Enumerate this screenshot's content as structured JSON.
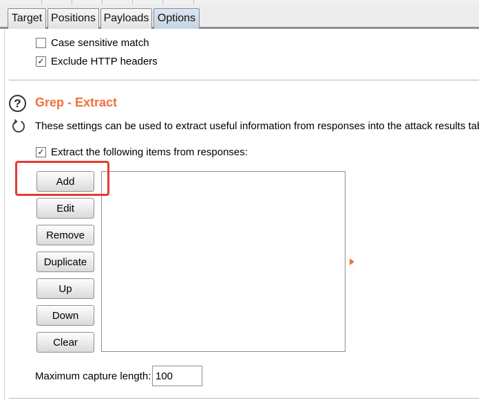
{
  "tabs": [
    {
      "label": "Target",
      "active": false
    },
    {
      "label": "Positions",
      "active": false
    },
    {
      "label": "Payloads",
      "active": false
    },
    {
      "label": "Options",
      "active": true
    }
  ],
  "grep_match_options": {
    "case_sensitive": {
      "label": "Case sensitive match",
      "checked": false
    },
    "exclude_headers": {
      "label": "Exclude HTTP headers",
      "checked": true
    }
  },
  "grep_extract": {
    "title": "Grep - Extract",
    "description": "These settings can be used to extract useful information from responses into the attack results table.",
    "extract_checkbox": {
      "label": "Extract the following items from responses:",
      "checked": true
    },
    "buttons": {
      "add": "Add",
      "edit": "Edit",
      "remove": "Remove",
      "duplicate": "Duplicate",
      "up": "Up",
      "down": "Down",
      "clear": "Clear"
    },
    "items": [],
    "max_capture": {
      "label": "Maximum capture length:",
      "value": "100"
    }
  },
  "icons": {
    "help": "help-question-icon",
    "refresh": "refresh-icon",
    "check": "✓"
  },
  "colors": {
    "title": "#f0713a",
    "highlight": "#e83a2e",
    "active_tab": "#c6d4e2"
  }
}
